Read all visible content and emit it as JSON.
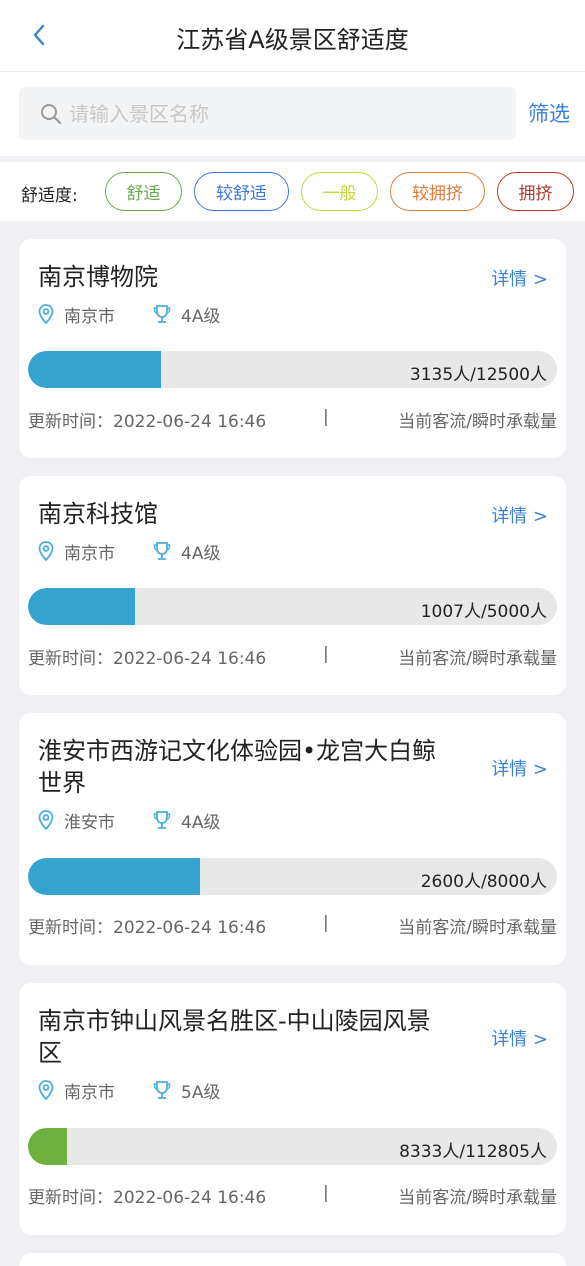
{
  "header": {
    "title": "江苏省A级景区舒适度",
    "back_icon": "chevron-left-icon"
  },
  "search": {
    "placeholder": "请输入景区名称",
    "value": "",
    "filter_label": "筛选"
  },
  "comfort": {
    "label": "舒适度:",
    "chips": [
      {
        "label": "舒适",
        "color": "#6aa84f"
      },
      {
        "label": "较舒适",
        "color": "#3c78d8"
      },
      {
        "label": "一般",
        "color": "#c9d63b"
      },
      {
        "label": "较拥挤",
        "color": "#e07b39"
      },
      {
        "label": "拥挤",
        "color": "#b03a2e"
      }
    ]
  },
  "cards": [
    {
      "name": "南京博物院",
      "detail": "详情 >",
      "city": "南京市",
      "level": "4A级",
      "current": 3135,
      "capacity": 12500,
      "count_text": "3135人/12500人",
      "bar_color": "#36a3cf",
      "update_text": "更新时间：2022-06-24 16:46",
      "sep": "|",
      "note": "当前客流/瞬时承载量"
    },
    {
      "name": "南京科技馆",
      "detail": "详情 >",
      "city": "南京市",
      "level": "4A级",
      "current": 1007,
      "capacity": 5000,
      "count_text": "1007人/5000人",
      "bar_color": "#36a3cf",
      "update_text": "更新时间：2022-06-24 16:46",
      "sep": "|",
      "note": "当前客流/瞬时承载量"
    },
    {
      "name": "淮安市西游记文化体验园•龙宫大白鲸世界",
      "detail": "详情 >",
      "city": "淮安市",
      "level": "4A级",
      "current": 2600,
      "capacity": 8000,
      "count_text": "2600人/8000人",
      "bar_color": "#36a3cf",
      "update_text": "更新时间：2022-06-24 16:46",
      "sep": "|",
      "note": "当前客流/瞬时承载量"
    },
    {
      "name": "南京市钟山风景名胜区-中山陵园风景区",
      "detail": "详情 >",
      "city": "南京市",
      "level": "5A级",
      "current": 8333,
      "capacity": 112805,
      "count_text": "8333人/112805人",
      "bar_color": "#6fb13f",
      "update_text": "更新时间：2022-06-24 16:46",
      "sep": "|",
      "note": "当前客流/瞬时承载量"
    }
  ],
  "colors": {
    "accent": "#3b82d6",
    "icon": "#4aaee0"
  }
}
